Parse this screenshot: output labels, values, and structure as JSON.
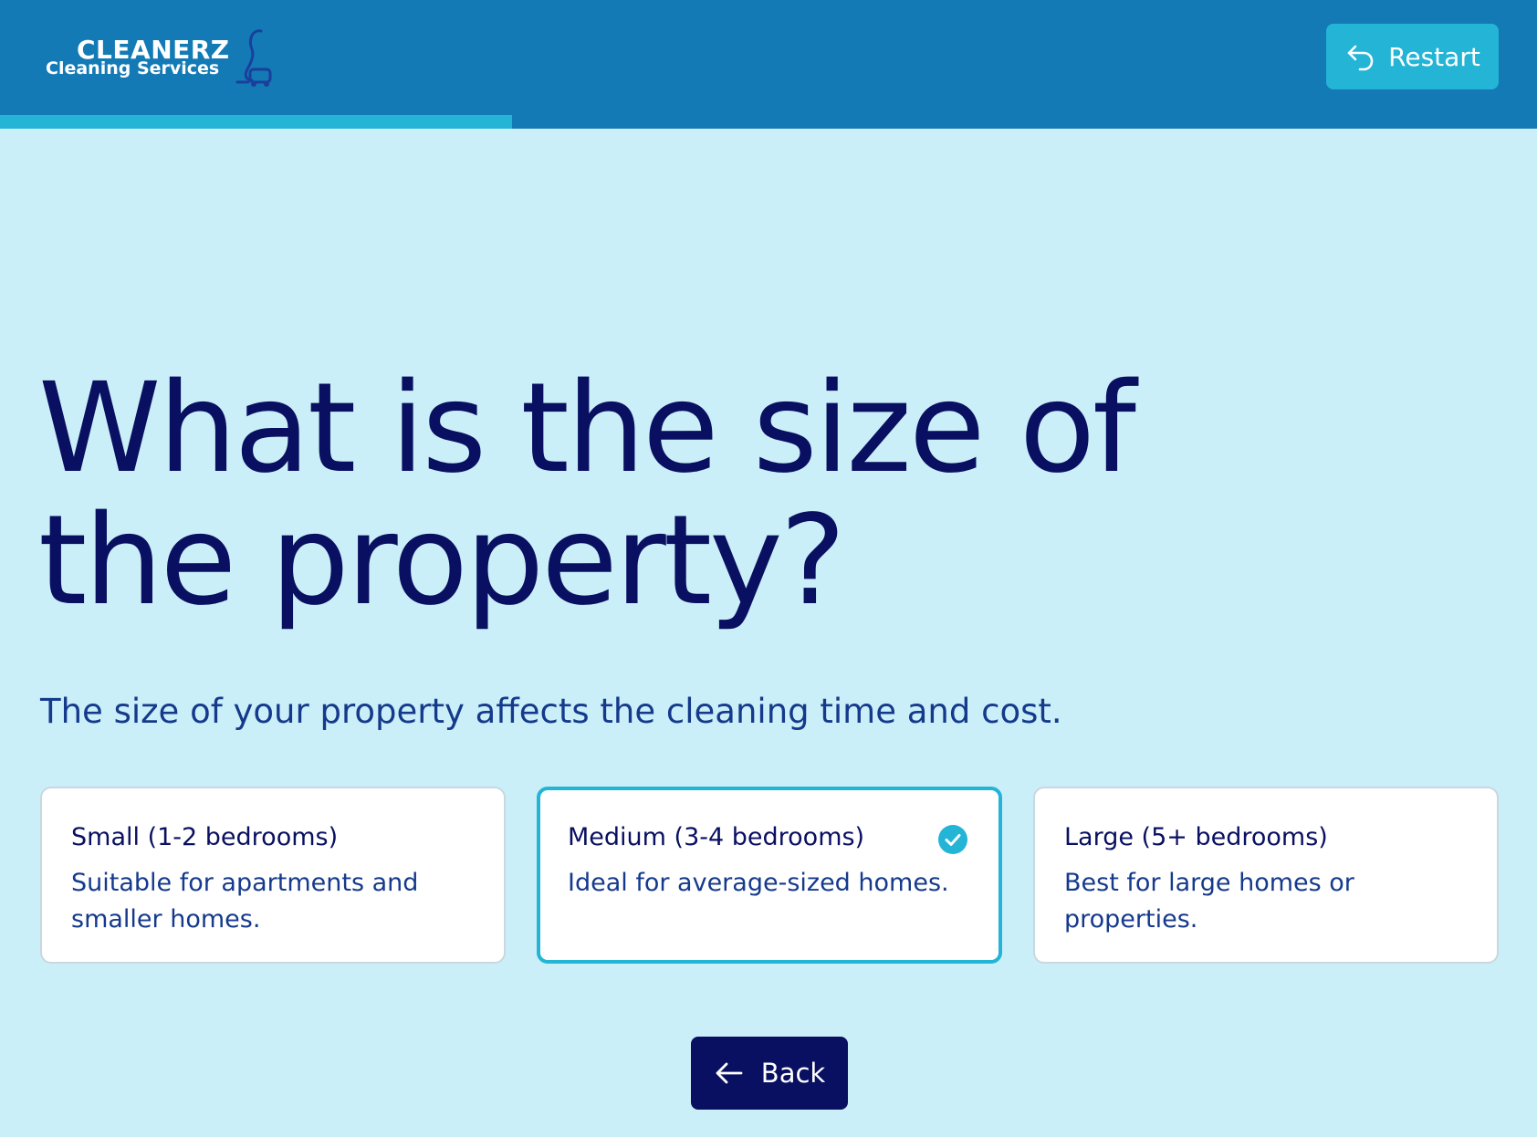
{
  "brand": {
    "name": "CLEANERZ",
    "tagline": "Cleaning Services"
  },
  "header": {
    "restart_label": "Restart",
    "progress_fraction": 0.333
  },
  "question": {
    "title": "What is the size of the property?",
    "subtitle": "The size of your property affects the cleaning time and cost."
  },
  "options": [
    {
      "title": "Small (1-2 bedrooms)",
      "description": "Suitable for apartments and smaller homes.",
      "selected": false
    },
    {
      "title": "Medium (3-4 bedrooms)",
      "description": "Ideal for average-sized homes.",
      "selected": true
    },
    {
      "title": "Large (5+ bedrooms)",
      "description": "Best for large homes or properties.",
      "selected": false
    }
  ],
  "nav": {
    "back_label": "Back"
  },
  "icons": {
    "restart": "undo-arrow-icon",
    "back": "arrow-left-icon",
    "selected": "check-circle-icon",
    "logo": "vacuum-cleaner-icon"
  },
  "colors": {
    "header_bg": "#137ab5",
    "accent": "#23b4d6",
    "page_bg": "#cbeff8",
    "primary_text": "#0a1061",
    "secondary_text": "#153a8c"
  }
}
